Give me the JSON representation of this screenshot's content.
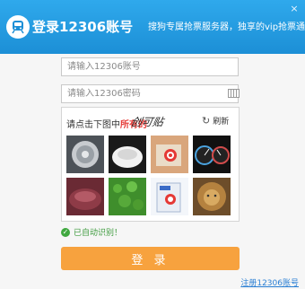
{
  "window": {
    "title": "登录12306账号",
    "promo": "搜狗专属抢票服务器，独享的vip抢票通道",
    "close_symbol": "×"
  },
  "form": {
    "account_placeholder": "请输入12306账号",
    "password_placeholder": "请输入12306密码"
  },
  "captcha": {
    "prompt_prefix": "请点击下图中",
    "prompt_highlight": "所有的",
    "target_word": "创可贴",
    "refresh_label": "刷新",
    "tiles": [
      {
        "subject": "drain-strainer"
      },
      {
        "subject": "white-bowl"
      },
      {
        "subject": "bandage-box"
      },
      {
        "subject": "dashboard-gauges"
      },
      {
        "subject": "red-beans"
      },
      {
        "subject": "green-beans"
      },
      {
        "subject": "bandage-pack"
      },
      {
        "subject": "lion"
      }
    ]
  },
  "status": {
    "auto_recognized": "已自动识别！"
  },
  "actions": {
    "login_label": "登 录",
    "register_label": "注册12306账号"
  },
  "colors": {
    "header": "#1c8fd6",
    "login_button": "#f7a23e",
    "prompt_highlight": "#e53935",
    "success": "#3fa83f",
    "link": "#2a7fd4"
  }
}
